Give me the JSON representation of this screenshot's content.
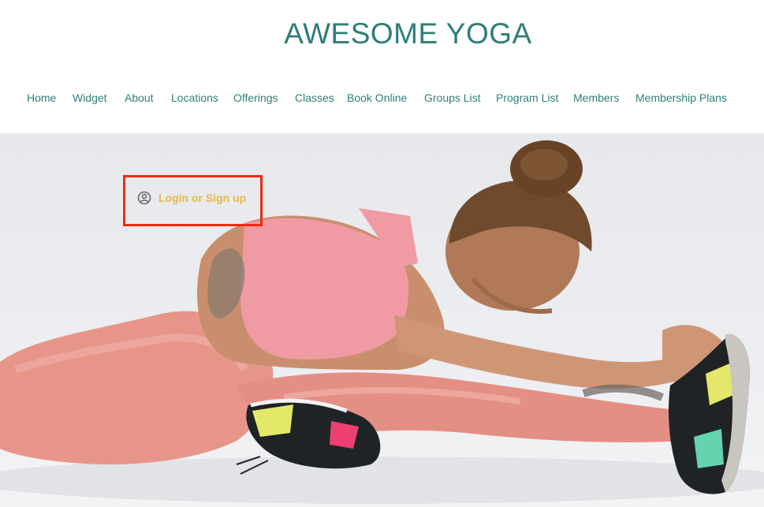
{
  "header": {
    "site_title": "AWESOME YOGA"
  },
  "nav": {
    "items": [
      {
        "label": "Home"
      },
      {
        "label": "Widget"
      },
      {
        "label": "About"
      },
      {
        "label": "Locations"
      },
      {
        "label": "Offerings"
      },
      {
        "label": "Classes"
      },
      {
        "label": "Book Online"
      },
      {
        "label": "Groups List"
      },
      {
        "label": "Program List"
      },
      {
        "label": "Members"
      },
      {
        "label": "Membership Plans"
      }
    ]
  },
  "login": {
    "label": "Login or Sign up",
    "icon": "user-circle-icon"
  },
  "colors": {
    "brand": "#2e7e78",
    "login_text": "#e9b84a",
    "highlight_border": "#f02a12"
  }
}
